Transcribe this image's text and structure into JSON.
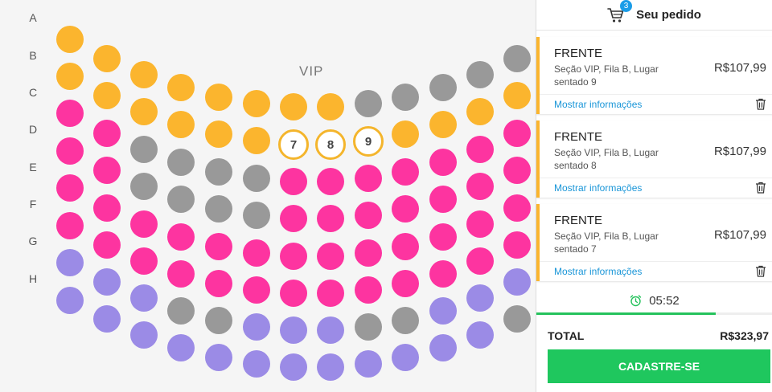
{
  "seatmap": {
    "section_label": "VIP",
    "row_labels": [
      "A",
      "B",
      "C",
      "D",
      "E",
      "F",
      "G",
      "H"
    ],
    "selected_seats": [
      "7",
      "8",
      "9"
    ],
    "colors": {
      "gold": "#fbb52e",
      "pink": "#fd34a0",
      "unavailable_gray": "#999999",
      "purple": "#9b8be6",
      "selected_border": "#f4b52c"
    }
  },
  "order_panel": {
    "cart_count": "3",
    "title": "Seu pedido",
    "items": [
      {
        "type": "FRENTE",
        "description": "Seção VIP, Fila B, Lugar sentado 9",
        "price": "R$107,99",
        "link": "Mostrar informações"
      },
      {
        "type": "FRENTE",
        "description": "Seção VIP, Fila B, Lugar sentado 8",
        "price": "R$107,99",
        "link": "Mostrar informações"
      },
      {
        "type": "FRENTE",
        "description": "Seção VIP, Fila B, Lugar sentado 7",
        "price": "R$107,99",
        "link": "Mostrar informações"
      }
    ],
    "timer": "05:52",
    "timer_progress": 0.76,
    "total_label": "TOTAL",
    "total_value": "R$323,97",
    "cta_label": "CADASTRE-SE",
    "accent_green": "#1fc75e",
    "link_blue": "#1a96d8"
  }
}
